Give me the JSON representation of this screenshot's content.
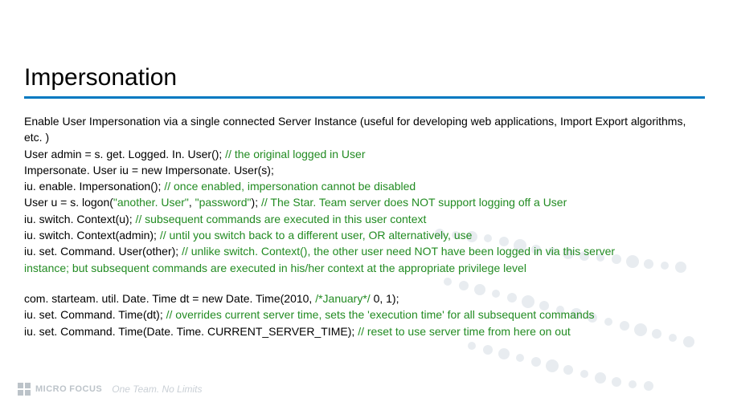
{
  "title": "Impersonation",
  "intro": "Enable User Impersonation via a single connected Server Instance (useful for developing web applications, Import Export algorithms, etc. )",
  "lines": [
    {
      "code": "User admin = s. get. Logged. In. User(); ",
      "comment": "// the original logged in User"
    },
    {
      "code": "Impersonate. User iu = new Impersonate. User(s);",
      "comment": ""
    },
    {
      "code": "iu. enable. Impersonation(); ",
      "comment": "// once enabled, impersonation cannot be disabled"
    },
    {
      "code": "User u = s. logon(",
      "q1": "\"another. User\"",
      "mid": ", ",
      "q2": "\"password\"",
      "tail": "); ",
      "comment": "// The Star. Team server does NOT support logging off a User"
    },
    {
      "code": "iu. switch. Context(u); ",
      "comment": "// subsequent commands are executed in this user context"
    },
    {
      "code": "iu. switch. Context(admin); ",
      "comment": "// until you switch back to a different user, OR alternatively, use"
    },
    {
      "code": "iu. set. Command. User(other); ",
      "comment": "// unlike switch. Context(), the other user need NOT have been logged in via this server"
    },
    {
      "code": " instance; but subsequent commands are executed in his/her context at the appropriate privilege level",
      "comment": "",
      "allGreen": true
    }
  ],
  "lines2": [
    {
      "code": "com. starteam. util. Date. Time dt = new Date. Time(2010, ",
      "cmt1": "/*January*/",
      "tail": " 0, 1);"
    },
    {
      "code": "iu. set. Command. Time(dt); ",
      "comment": "// overrides current server time, sets the 'execution time' for all subsequent commands"
    },
    {
      "code": "iu. set. Command. Time(Date. Time. CURRENT_SERVER_TIME); ",
      "comment": "// reset to use server time from here on out"
    }
  ],
  "logo": {
    "brand1": "MICRO",
    "brand2": "FOCUS",
    "tagline": "One Team. No Limits"
  }
}
